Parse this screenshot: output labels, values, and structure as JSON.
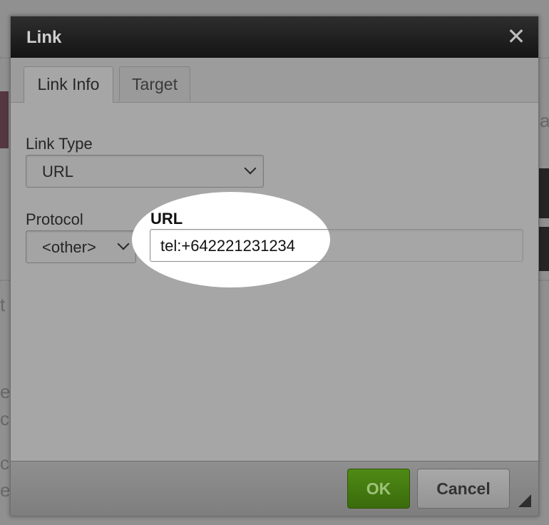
{
  "dialog": {
    "title": "Link",
    "close_glyph": "✕",
    "tabs": [
      {
        "label": "Link Info",
        "active": true
      },
      {
        "label": "Target",
        "active": false
      }
    ],
    "link_type": {
      "label": "Link Type",
      "value": "URL"
    },
    "protocol": {
      "label": "Protocol",
      "value": "<other>"
    },
    "url": {
      "label": "URL",
      "value": "tel:+642221231234"
    },
    "buttons": {
      "ok": "OK",
      "cancel": "Cancel"
    }
  },
  "colors": {
    "ok_button": "#4f8a14",
    "titlebar": "#1e1e1e",
    "highlight_spot": "#ffffff"
  },
  "icons": {
    "close": "close-icon",
    "dropdown": "chevron-down-icon",
    "resize": "resize-handle-icon"
  }
}
